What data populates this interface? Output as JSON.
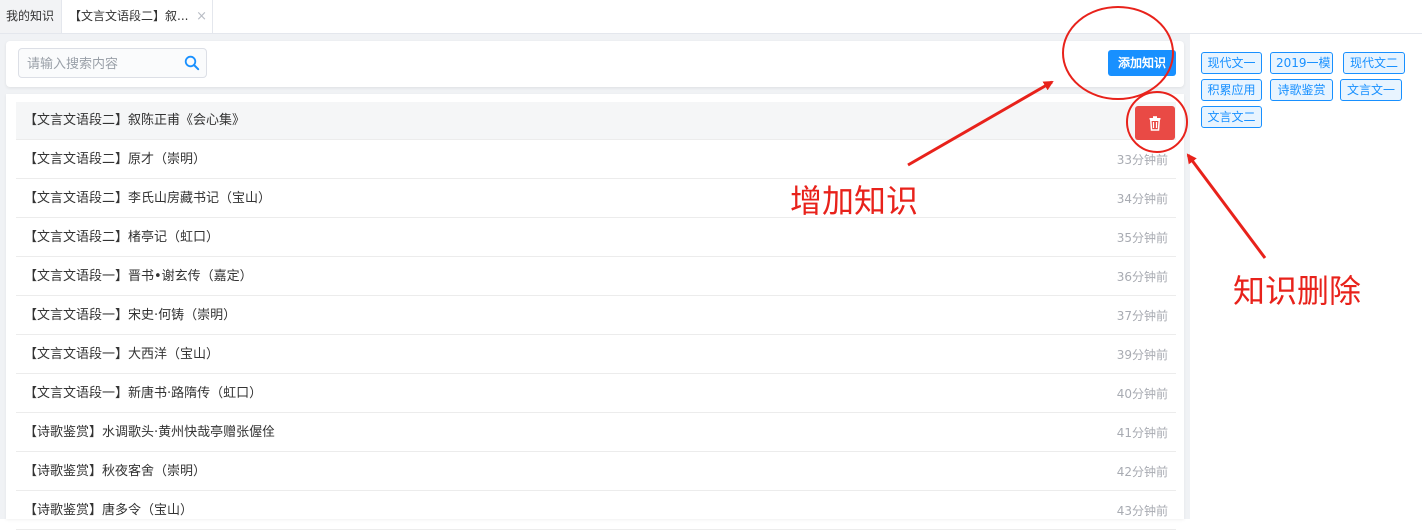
{
  "tabs": [
    {
      "label": "我的知识"
    },
    {
      "label": "【文言文语段二】叙...",
      "close": "×"
    }
  ],
  "search": {
    "placeholder": "请输入搜索内容",
    "icon": "search-icon"
  },
  "add_button": {
    "label": "添加知识"
  },
  "delete_button": {
    "icon": "trash-icon",
    "color": "#e94a45"
  },
  "list": [
    {
      "title": "【文言文语段二】叙陈正甫《会心集》",
      "time": ""
    },
    {
      "title": "【文言文语段二】原才（崇明）",
      "time": "33分钟前"
    },
    {
      "title": "【文言文语段二】李氏山房藏书记（宝山）",
      "time": "34分钟前"
    },
    {
      "title": "【文言文语段二】楮亭记（虹口）",
      "time": "35分钟前"
    },
    {
      "title": "【文言文语段一】晋书•谢玄传（嘉定）",
      "time": "36分钟前"
    },
    {
      "title": "【文言文语段一】宋史·何铸（崇明）",
      "time": "37分钟前"
    },
    {
      "title": "【文言文语段一】大西洋（宝山）",
      "time": "39分钟前"
    },
    {
      "title": "【文言文语段一】新唐书·路隋传（虹口）",
      "time": "40分钟前"
    },
    {
      "title": "【诗歌鉴赏】水调歌头·黄州快哉亭赠张偓佺",
      "time": "41分钟前"
    },
    {
      "title": "【诗歌鉴赏】秋夜客舍（崇明）",
      "time": "42分钟前"
    },
    {
      "title": "【诗歌鉴赏】唐多令（宝山）",
      "time": "43分钟前"
    }
  ],
  "tags": [
    "现代文一",
    "2019一模",
    "现代文二",
    "积累应用",
    "诗歌鉴赏",
    "文言文一",
    "文言文二"
  ],
  "annotations": {
    "add": "增加知识",
    "delete": "知识删除",
    "color": "#e8221b"
  },
  "colors": {
    "accent": "#1890ff",
    "danger": "#e94a45"
  }
}
